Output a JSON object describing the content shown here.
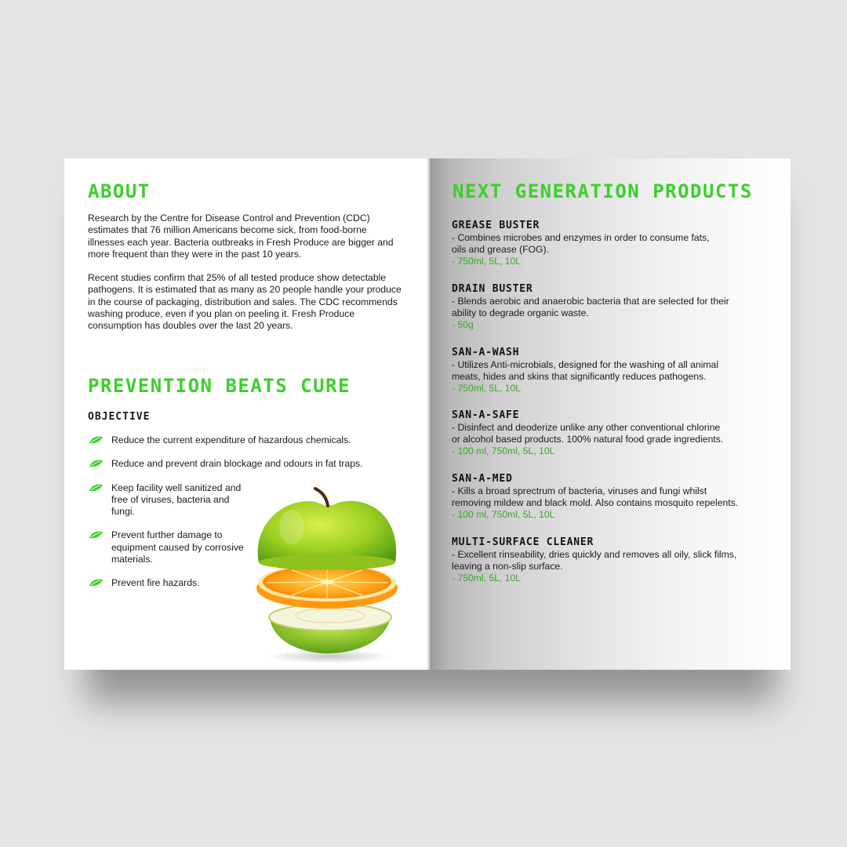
{
  "left_page": {
    "about_title": "ABOUT",
    "about_paragraph_1": "Research by the Centre for Disease Control and Prevention (CDC) estimates that 76 million Americans become sick, from food-borne illnesses each year. Bacteria outbreaks in Fresh Produce are bigger and more frequent than they were in the past 10 years.",
    "about_paragraph_2": "Recent studies confirm that 25% of all tested produce show detectable pathogens. It is estimated that as many as 20 people handle your produce in the course of packaging, distribution and sales. The CDC recommends washing produce, even if you plan on peeling it. Fresh Produce consumption has doubles over the last 20 years.",
    "prevention_title": "PREVENTION BEATS CURE",
    "objective_label": "OBJECTIVE",
    "objectives": [
      "Reduce the current expenditure of hazardous chemicals.",
      "Reduce and prevent drain blockage and odours in fat traps.",
      "Keep facility well sanitized and free of viruses, bacteria and fungi.",
      "Prevent further damage to equipment caused by corrosive materials.",
      "Prevent fire hazards."
    ]
  },
  "right_page": {
    "title": "NEXT GENERATION PRODUCTS",
    "products": [
      {
        "name": "GREASE BUSTER",
        "description": "- Combines microbes and enzymes in order to consume fats,\n  oils and grease (FOG).",
        "sizes": "- 750ml, 5L, 10L"
      },
      {
        "name": "DRAIN BUSTER",
        "description": "- Blends aerobic and anaerobic bacteria that are selected for their\n  ability to degrade organic waste.",
        "sizes": "- 50g"
      },
      {
        "name": "SAN-A-WASH",
        "description": "- Utilizes Anti-microbials, designed for the washing of all animal\n  meats, hides and skins that significantly reduces pathogens.",
        "sizes": "- 750ml, 5L, 10L"
      },
      {
        "name": "SAN-A-SAFE",
        "description": "- Disinfect and deoderize unlike any other conventional chlorine\n  or alcohol based products. 100% natural food grade ingredients.",
        "sizes": "- 100 ml, 750ml, 5L, 10L"
      },
      {
        "name": "SAN-A-MED",
        "description": "- Kills a broad sprectrum of bacteria, viruses and fungi whilst\n  removing mildew and black mold. Also contains mosquito repelents.",
        "sizes": "- 100 ml, 750ml, 5L, 10L"
      },
      {
        "name": "MULTI-SURFACE CLEANER",
        "description": "- Excellent rinseability, dries quickly and removes all oily, slick films,\n  leaving a non-slip surface.",
        "sizes": "- 750ml, 5L, 10L"
      }
    ]
  },
  "colors": {
    "accent_green": "#3ccf2a",
    "size_green": "#3aa82b",
    "text": "#1a1a1a",
    "background": "#e4e4e4"
  },
  "icons": {
    "bullet": "leaf-icon",
    "illustration": "stacked-fruit-image"
  }
}
